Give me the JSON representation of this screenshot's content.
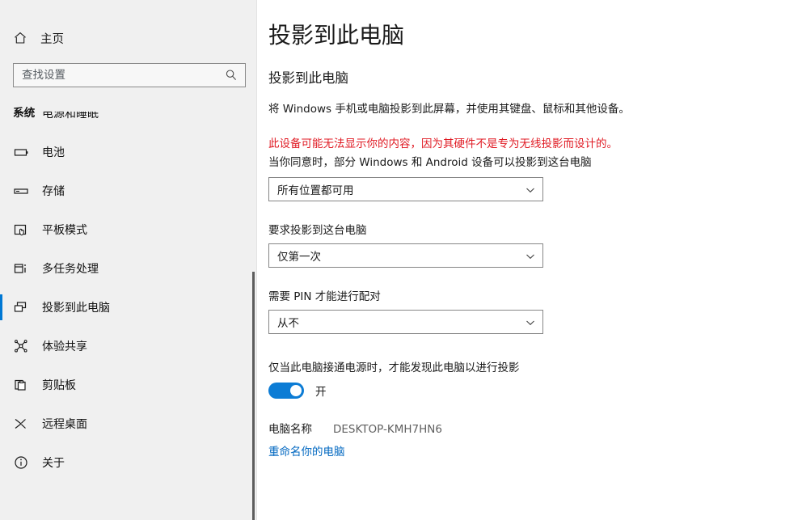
{
  "sidebar": {
    "home": {
      "label": "主页",
      "icon": "home-icon"
    },
    "search": {
      "value": "",
      "placeholder": "查找设置",
      "icon": "search-icon"
    },
    "group_title": "系统",
    "items": [
      {
        "label": "电源和睡眠",
        "icon": "power-sleep-icon",
        "active": false,
        "clipped": true
      },
      {
        "label": "电池",
        "icon": "battery-icon",
        "active": false
      },
      {
        "label": "存储",
        "icon": "storage-icon",
        "active": false
      },
      {
        "label": "平板模式",
        "icon": "tablet-mode-icon",
        "active": false
      },
      {
        "label": "多任务处理",
        "icon": "multitasking-icon",
        "active": false
      },
      {
        "label": "投影到此电脑",
        "icon": "project-to-pc-icon",
        "active": true
      },
      {
        "label": "体验共享",
        "icon": "shared-experiences-icon",
        "active": false
      },
      {
        "label": "剪贴板",
        "icon": "clipboard-icon",
        "active": false
      },
      {
        "label": "远程桌面",
        "icon": "remote-desktop-icon",
        "active": false
      },
      {
        "label": "关于",
        "icon": "info-icon",
        "active": false
      }
    ]
  },
  "main": {
    "page_title": "投影到此电脑",
    "section_heading": "投影到此电脑",
    "description": "将 Windows 手机或电脑投影到此屏幕，并使用其键盘、鼠标和其他设备。",
    "warning": "此设备可能无法显示你的内容，因为其硬件不是专为无线投影而设计的。",
    "subnote": "当你同意时，部分 Windows 和 Android 设备可以投影到这台电脑",
    "dropdown_availability": {
      "value": "所有位置都可用",
      "icon": "chevron-down-icon"
    },
    "request_label": "要求投影到这台电脑",
    "dropdown_request": {
      "value": "仅第一次",
      "icon": "chevron-down-icon"
    },
    "pin_label": "需要 PIN 才能进行配对",
    "dropdown_pin": {
      "value": "从不",
      "icon": "chevron-down-icon"
    },
    "power_toggle_label": "仅当此电脑接通电源时，才能发现此电脑以进行投影",
    "power_toggle_state": "开",
    "pc_name_label": "电脑名称",
    "pc_name_value": "DESKTOP-KMH7HN6",
    "rename_link": "重命名你的电脑"
  },
  "colors": {
    "accent": "#0078d4",
    "toggle_on": "#0c7cd5",
    "warning_red": "#e01b24",
    "link_blue": "#0067c0",
    "sidebar_bg": "#f0f0f0",
    "main_bg": "#ffffff"
  }
}
